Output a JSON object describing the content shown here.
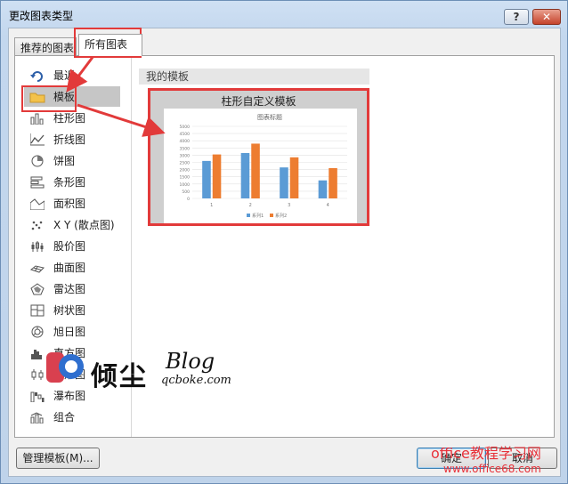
{
  "window": {
    "title": "更改图表类型",
    "help_label": "?",
    "close_label": "✕"
  },
  "tabs": [
    {
      "label": "推荐的图表"
    },
    {
      "label": "所有图表"
    }
  ],
  "sidebar": {
    "items": [
      {
        "label": "最近",
        "icon": "recent-icon"
      },
      {
        "label": "模板",
        "icon": "folder-icon",
        "selected": true
      },
      {
        "label": "柱形图",
        "icon": "column-chart-icon"
      },
      {
        "label": "折线图",
        "icon": "line-chart-icon"
      },
      {
        "label": "饼图",
        "icon": "pie-chart-icon"
      },
      {
        "label": "条形图",
        "icon": "bar-chart-icon"
      },
      {
        "label": "面积图",
        "icon": "area-chart-icon"
      },
      {
        "label": "X Y (散点图)",
        "icon": "scatter-chart-icon"
      },
      {
        "label": "股价图",
        "icon": "stock-chart-icon"
      },
      {
        "label": "曲面图",
        "icon": "surface-chart-icon"
      },
      {
        "label": "雷达图",
        "icon": "radar-chart-icon"
      },
      {
        "label": "树状图",
        "icon": "treemap-chart-icon"
      },
      {
        "label": "旭日图",
        "icon": "sunburst-chart-icon"
      },
      {
        "label": "直方图",
        "icon": "histogram-chart-icon"
      },
      {
        "label": "箱形图",
        "icon": "box-whisker-chart-icon"
      },
      {
        "label": "瀑布图",
        "icon": "waterfall-chart-icon"
      },
      {
        "label": "组合",
        "icon": "combo-chart-icon"
      }
    ]
  },
  "content": {
    "section_title": "我的模板",
    "template": {
      "name": "柱形自定义模板",
      "chart_data": {
        "type": "bar",
        "title": "图表标题",
        "categories": [
          "1",
          "2",
          "3",
          "4"
        ],
        "series": [
          {
            "name": "系列1",
            "values": [
              2600,
              3150,
              2150,
              1250
            ],
            "color": "#5b9bd5"
          },
          {
            "name": "系列2",
            "values": [
              3050,
              3800,
              2850,
              2100
            ],
            "color": "#ed7d31"
          }
        ],
        "ylim": [
          0,
          5000
        ],
        "yticks": [
          "0",
          "500",
          "1000",
          "1500",
          "2000",
          "2500",
          "3000",
          "3500",
          "4000",
          "4500",
          "5000"
        ],
        "grid": true,
        "legend": "bottom"
      }
    }
  },
  "footer": {
    "manage_label": "管理模板(M)...",
    "ok_label": "确定",
    "cancel_label": "取消"
  },
  "watermarks": {
    "brand": "倾尘",
    "blog": "Blog",
    "domain": "qcboke.com",
    "site_name": "office教程学习网",
    "site_url": "www.office68.com"
  },
  "colors": {
    "highlight": "#e23a3a",
    "series1": "#5b9bd5",
    "series2": "#ed7d31"
  }
}
